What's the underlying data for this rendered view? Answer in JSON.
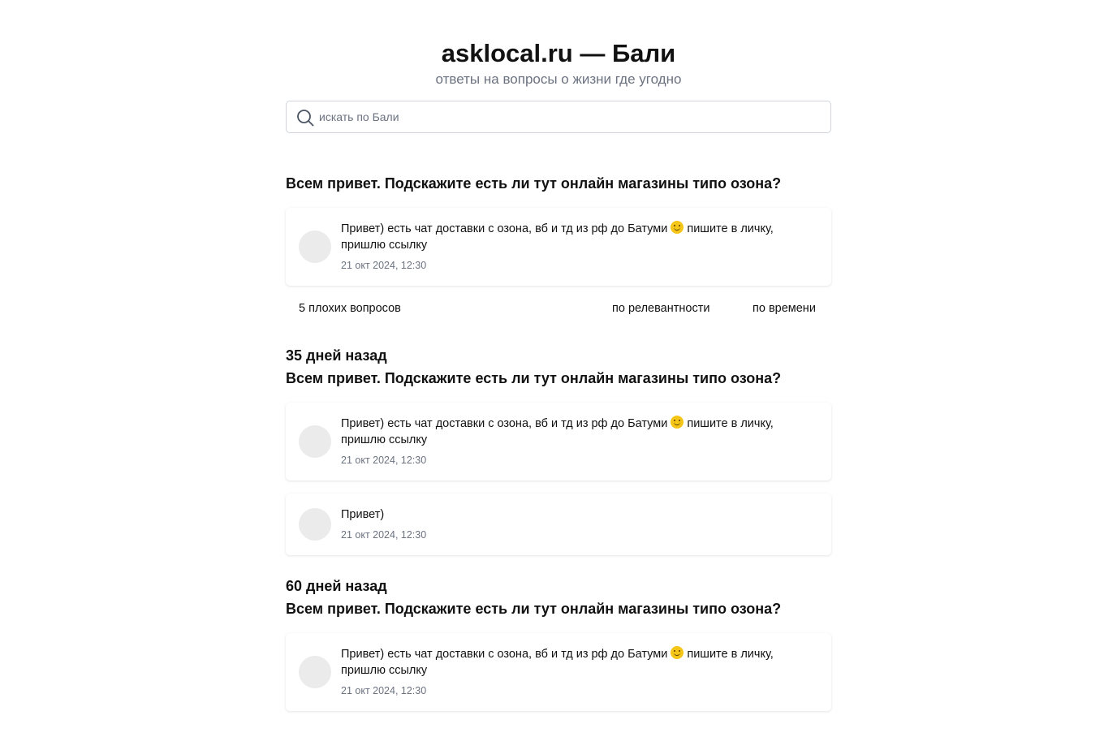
{
  "header": {
    "title": "asklocal.ru — Бали",
    "subtitle": "ответы на вопросы о жизни где угодно"
  },
  "search": {
    "placeholder": "искать по Бали",
    "value": "",
    "icon": "search-icon"
  },
  "featured": {
    "question": "Всем привет. Подскажите есть ли тут онлайн магазины типо озона?",
    "answers": [
      {
        "text_before_emoji": "Привет) есть чат доставки с озона, вб и тд из рф до Батуми ",
        "emoji": "smiling-face-emoji",
        "text_after_emoji": " пишите в личку, пришлю ссылку",
        "time": "21 окт 2024, 12:30"
      }
    ]
  },
  "filters": {
    "bad_questions": "5 плохих вопросов",
    "sort_relevance": "по релевантности",
    "sort_time": "по времени"
  },
  "groups": [
    {
      "date": "35 дней назад",
      "question": "Всем привет. Подскажите есть ли тут онлайн магазины типо озона?",
      "answers": [
        {
          "text_before_emoji": "Привет) есть чат доставки с озона, вб и тд из рф до Батуми ",
          "emoji": "smiling-face-emoji",
          "text_after_emoji": " пишите в личку, пришлю ссылку",
          "time": "21 окт 2024, 12:30"
        },
        {
          "text": "Привет)",
          "time": "21 окт 2024, 12:30"
        }
      ]
    },
    {
      "date": "60 дней назад",
      "question": "Всем привет. Подскажите есть ли тут онлайн магазины типо озона?",
      "answers": [
        {
          "text_before_emoji": "Привет) есть чат доставки с озона, вб и тд из рф до Батуми ",
          "emoji": "smiling-face-emoji",
          "text_after_emoji": " пишите в личку, пришлю ссылку",
          "time": "21 окт 2024, 12:30"
        }
      ]
    }
  ],
  "colors": {
    "text": "#111111",
    "muted": "#6b7280",
    "border": "#d1d5db",
    "avatar": "#ebebeb",
    "emoji": "#f5c518"
  }
}
